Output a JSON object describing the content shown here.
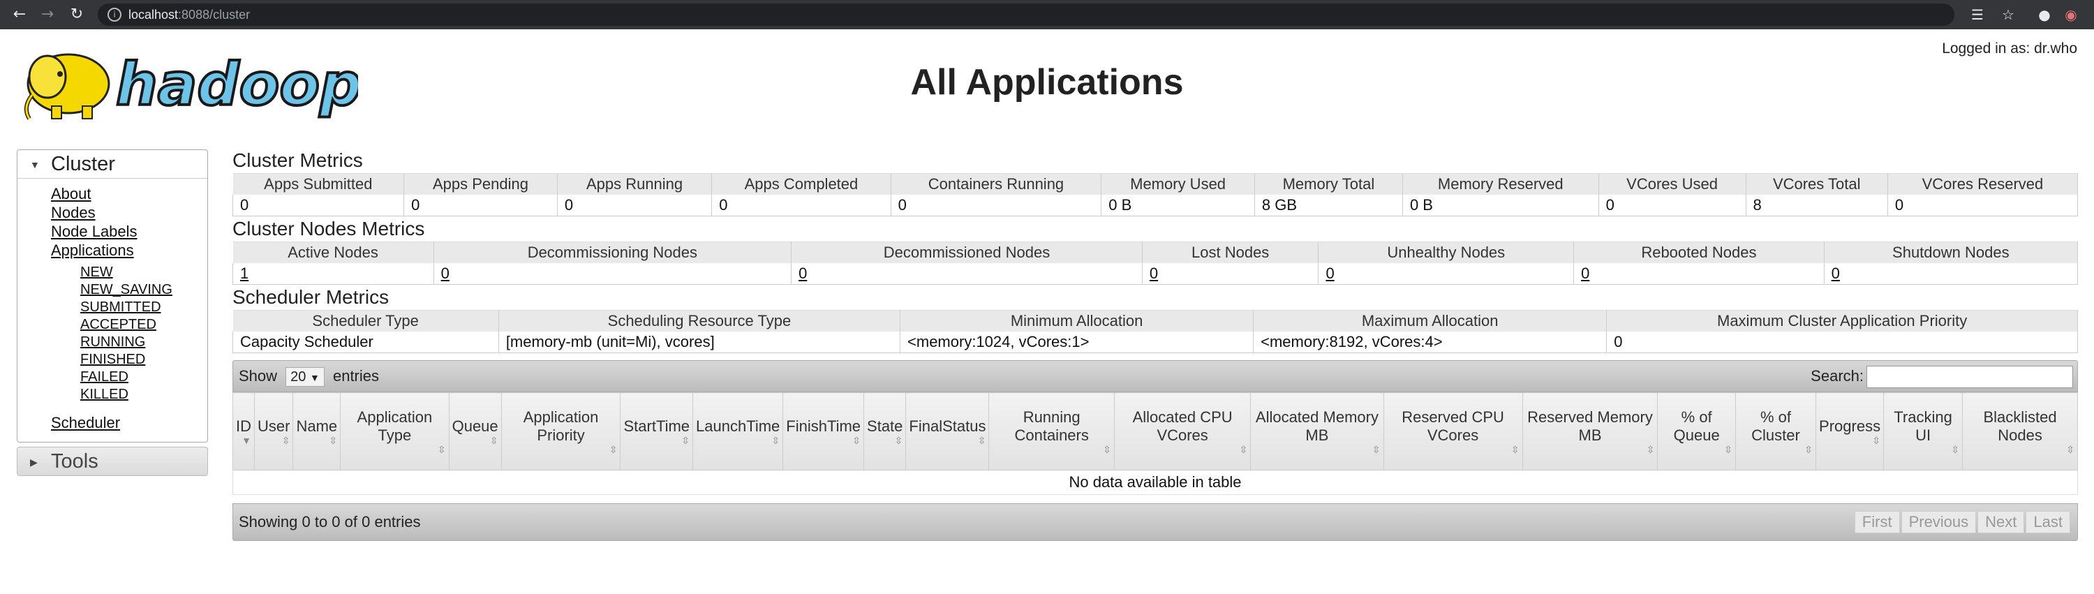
{
  "browser": {
    "url_host": "localhost",
    "url_path": ":8088/cluster",
    "icons": [
      "back-icon",
      "forward-icon",
      "reload-icon",
      "translate-icon",
      "star-icon",
      "profile-icon",
      "extension-icon"
    ]
  },
  "header": {
    "logo_text": "hadoop",
    "title": "All Applications",
    "logged_in": "Logged in as: dr.who"
  },
  "nav": {
    "cluster_label": "Cluster",
    "links": [
      "About",
      "Nodes",
      "Node Labels",
      "Applications"
    ],
    "app_states": [
      "NEW",
      "NEW_SAVING",
      "SUBMITTED",
      "ACCEPTED",
      "RUNNING",
      "FINISHED",
      "FAILED",
      "KILLED"
    ],
    "scheduler_label": "Scheduler",
    "tools_label": "Tools"
  },
  "cluster_metrics": {
    "title": "Cluster Metrics",
    "headers": [
      "Apps Submitted",
      "Apps Pending",
      "Apps Running",
      "Apps Completed",
      "Containers Running",
      "Memory Used",
      "Memory Total",
      "Memory Reserved",
      "VCores Used",
      "VCores Total",
      "VCores Reserved"
    ],
    "values": [
      "0",
      "0",
      "0",
      "0",
      "0",
      "0 B",
      "8 GB",
      "0 B",
      "0",
      "8",
      "0"
    ]
  },
  "node_metrics": {
    "title": "Cluster Nodes Metrics",
    "headers": [
      "Active Nodes",
      "Decommissioning Nodes",
      "Decommissioned Nodes",
      "Lost Nodes",
      "Unhealthy Nodes",
      "Rebooted Nodes",
      "Shutdown Nodes"
    ],
    "values": [
      "1",
      "0",
      "0",
      "0",
      "0",
      "0",
      "0"
    ]
  },
  "scheduler_metrics": {
    "title": "Scheduler Metrics",
    "headers": [
      "Scheduler Type",
      "Scheduling Resource Type",
      "Minimum Allocation",
      "Maximum Allocation",
      "Maximum Cluster Application Priority"
    ],
    "values": [
      "Capacity Scheduler",
      "[memory-mb (unit=Mi), vcores]",
      "<memory:1024, vCores:1>",
      "<memory:8192, vCores:4>",
      "0"
    ]
  },
  "apps_table": {
    "show_label": "Show",
    "page_size": "20",
    "entries_label": "entries",
    "search_label": "Search:",
    "search_value": "",
    "columns": [
      "ID",
      "User",
      "Name",
      "Application Type",
      "Queue",
      "Application Priority",
      "StartTime",
      "LaunchTime",
      "FinishTime",
      "State",
      "FinalStatus",
      "Running Containers",
      "Allocated CPU VCores",
      "Allocated Memory MB",
      "Reserved CPU VCores",
      "Reserved Memory MB",
      "% of Queue",
      "% of Cluster",
      "Progress",
      "Tracking UI",
      "Blacklisted Nodes"
    ],
    "empty_message": "No data available in table",
    "info": "Showing 0 to 0 of 0 entries",
    "pager": [
      "First",
      "Previous",
      "Next",
      "Last"
    ]
  }
}
